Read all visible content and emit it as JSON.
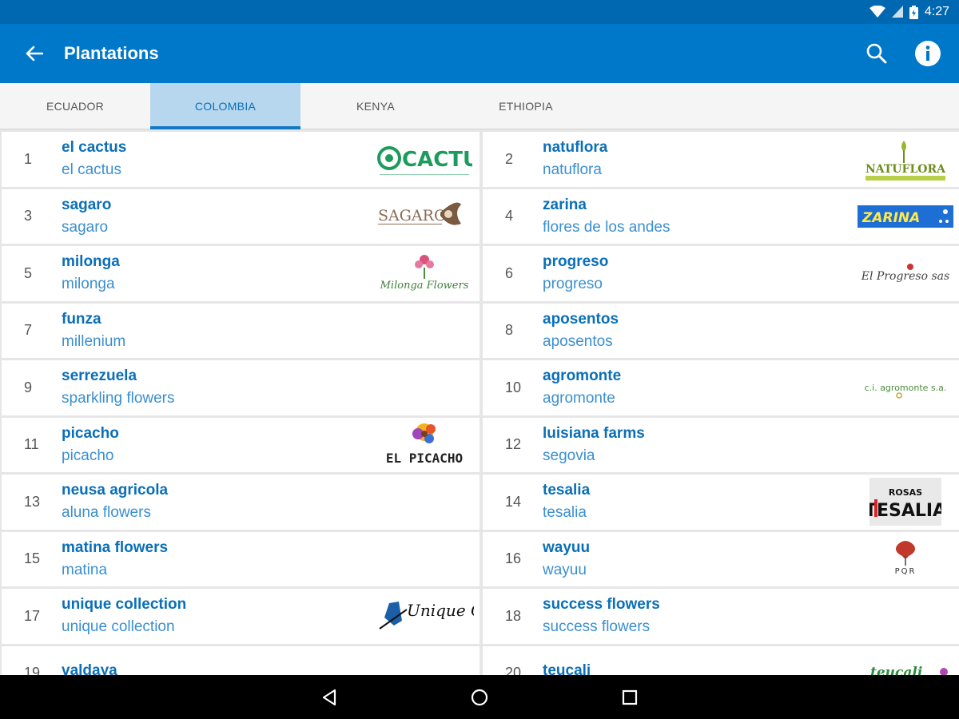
{
  "status": {
    "time": "4:27"
  },
  "app_bar": {
    "title": "Plantations"
  },
  "tabs": [
    {
      "label": "ECUADOR"
    },
    {
      "label": "COLOMBIA"
    },
    {
      "label": "KENYA"
    },
    {
      "label": "ETHIOPIA"
    }
  ],
  "plantations": [
    {
      "num": "1",
      "name": "el cactus",
      "sub": "el cactus",
      "logo": "CACTUS"
    },
    {
      "num": "2",
      "name": "natuflora",
      "sub": "natuflora",
      "logo": "NATUFLORA"
    },
    {
      "num": "3",
      "name": "sagaro",
      "sub": "sagaro",
      "logo": "SAGARO"
    },
    {
      "num": "4",
      "name": "zarina",
      "sub": "flores de los andes",
      "logo": "ZARINA"
    },
    {
      "num": "5",
      "name": "milonga",
      "sub": "milonga",
      "logo": "Milonga Flowers"
    },
    {
      "num": "6",
      "name": "progreso",
      "sub": "progreso",
      "logo": "El Progreso sas"
    },
    {
      "num": "7",
      "name": "funza",
      "sub": "millenium",
      "logo": ""
    },
    {
      "num": "8",
      "name": "aposentos",
      "sub": "aposentos",
      "logo": ""
    },
    {
      "num": "9",
      "name": "serrezuela",
      "sub": "sparkling flowers",
      "logo": ""
    },
    {
      "num": "10",
      "name": "agromonte",
      "sub": "agromonte",
      "logo": "c.i. agromonte s.a."
    },
    {
      "num": "11",
      "name": "picacho",
      "sub": "picacho",
      "logo": "EL PICACHO"
    },
    {
      "num": "12",
      "name": "luisiana farms",
      "sub": "segovia",
      "logo": ""
    },
    {
      "num": "13",
      "name": "neusa agricola",
      "sub": "aluna flowers",
      "logo": ""
    },
    {
      "num": "14",
      "name": "tesalia",
      "sub": "tesalia",
      "logo": "TESALIA"
    },
    {
      "num": "15",
      "name": "matina flowers",
      "sub": "matina",
      "logo": ""
    },
    {
      "num": "16",
      "name": "wayuu",
      "sub": "wayuu",
      "logo": "PQR"
    },
    {
      "num": "17",
      "name": "unique collection",
      "sub": "unique collection",
      "logo": "Unique Collection"
    },
    {
      "num": "18",
      "name": "success flowers",
      "sub": "success flowers",
      "logo": ""
    },
    {
      "num": "19",
      "name": "valdaya",
      "sub": "",
      "logo": ""
    },
    {
      "num": "20",
      "name": "teucali",
      "sub": "",
      "logo": "teucali"
    }
  ],
  "colors": {
    "status_bar": "#0068b0",
    "app_bar": "#0078c9",
    "tab_active_bg": "#b6d7ee",
    "tab_indicator": "#1378c4",
    "primary_text": "#0a6fb8",
    "secondary_text": "#3b8fd0"
  },
  "icons": {
    "status": [
      "wifi-icon",
      "signal-icon",
      "battery-icon"
    ],
    "app_bar": [
      "back-arrow-icon",
      "search-icon",
      "info-icon"
    ],
    "nav": [
      "nav-back-icon",
      "nav-home-icon",
      "nav-recents-icon"
    ]
  }
}
